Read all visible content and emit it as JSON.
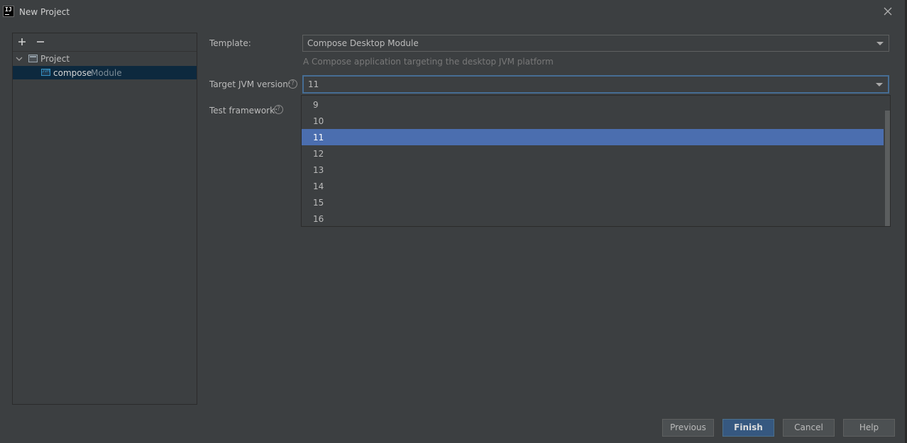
{
  "window": {
    "title": "New Project",
    "logo_text": "IJ"
  },
  "tree": {
    "project_label": "Project",
    "module_name": "compose",
    "module_type": "Module",
    "module_icon_text": "JVM"
  },
  "form": {
    "template_label": "Template:",
    "template_value": "Compose Desktop Module",
    "template_description": "A Compose application targeting the desktop JVM platform",
    "jvm_label": "Target JVM version:",
    "jvm_value": "11",
    "test_label": "Test framework:",
    "help_glyph": "?"
  },
  "dropdown": {
    "options": [
      "9",
      "10",
      "11",
      "12",
      "13",
      "14",
      "15",
      "16"
    ],
    "selected": "11"
  },
  "buttons": {
    "previous": "Previous",
    "finish": "Finish",
    "cancel": "Cancel",
    "help": "Help"
  },
  "colors": {
    "background": "#3c3f41",
    "selection": "#4b6eaf",
    "focus_border": "#466d94",
    "tree_selection": "#0d293e",
    "default_button": "#365880"
  },
  "icons": [
    "intellij-logo-icon",
    "close-icon",
    "add-icon",
    "remove-icon",
    "expand-icon",
    "project-folder-icon",
    "jvm-module-icon",
    "help-icon",
    "dropdown-arrow-icon"
  ]
}
